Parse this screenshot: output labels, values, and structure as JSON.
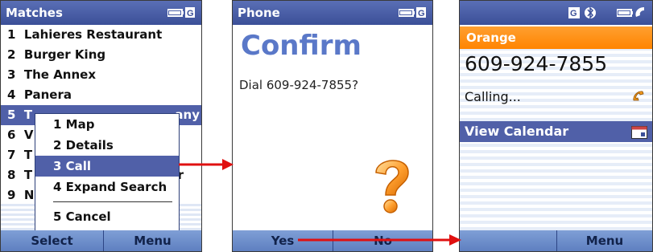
{
  "screen1": {
    "title": "Matches",
    "items": [
      {
        "num": "1",
        "label": "Lahieres Restaurant"
      },
      {
        "num": "2",
        "label": "Burger King"
      },
      {
        "num": "3",
        "label": "The Annex"
      },
      {
        "num": "4",
        "label": "Panera"
      },
      {
        "num": "5",
        "label": "T",
        "suffix": "any"
      },
      {
        "num": "6",
        "label": "V"
      },
      {
        "num": "7",
        "label": "T"
      },
      {
        "num": "8",
        "label": "T",
        "suffix": "r"
      },
      {
        "num": "9",
        "label": "N"
      }
    ],
    "menu": {
      "items": [
        "1 Map",
        "2 Details",
        "3 Call",
        "4 Expand Search",
        "5 Cancel"
      ]
    },
    "softkeys": {
      "left": "Select",
      "right": "Menu"
    }
  },
  "screen2": {
    "title": "Phone",
    "heading": "Confirm",
    "prompt": "Dial 609-924-7855?",
    "softkeys": {
      "left": "Yes",
      "right": "No"
    }
  },
  "screen3": {
    "operator": "Orange",
    "number": "609-924-7855",
    "status": "Calling...",
    "action": "View Calendar",
    "softkeys": {
      "left": "",
      "right": "Menu"
    }
  },
  "icons": [
    "battery-icon",
    "g-signal-icon",
    "bluetooth-icon",
    "phone-handset-icon",
    "calendar-icon",
    "question-mark-icon"
  ],
  "colors": {
    "titlebar": "#3b4f98",
    "selection": "#5060a8",
    "softbar": "#6f8fcb",
    "orange": "#ff8c1a",
    "confirm": "#5a78c8",
    "arrow": "#e01010"
  }
}
